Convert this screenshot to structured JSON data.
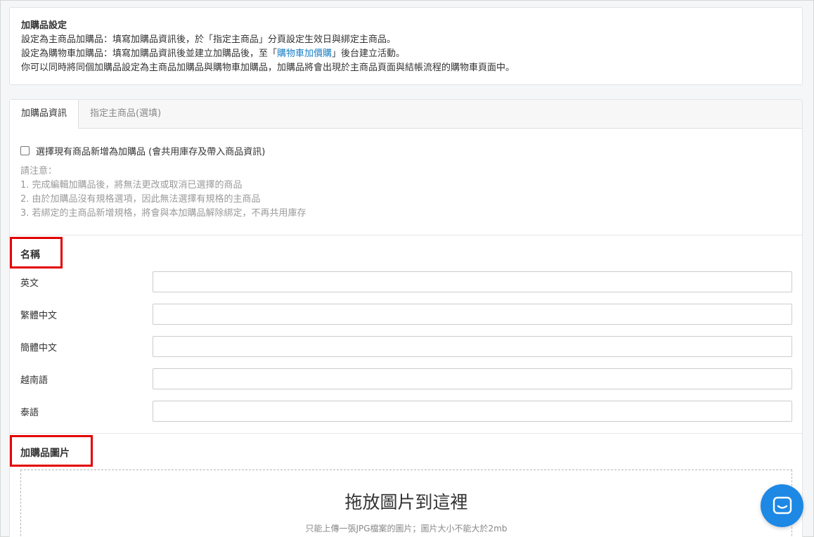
{
  "notice": {
    "title": "加購品設定",
    "line1": "設定為主商品加購品：填寫加購品資訊後，於「指定主商品」分頁設定生效日與綁定主商品。",
    "line2_prefix": "設定為購物車加購品：填寫加購品資訊後並建立加購品後，至「",
    "line2_link": "購物車加價購",
    "line2_suffix": "」後台建立活動。",
    "line3": "你可以同時將同個加購品設定為主商品加購品與購物車加購品，加購品將會出現於主商品頁面與結帳流程的購物車頁面中。"
  },
  "tabs": [
    {
      "label": "加購品資訊",
      "active": true
    },
    {
      "label": "指定主商品(選填)",
      "active": false
    }
  ],
  "existing_product": {
    "checkbox_label": "選擇現有商品新增為加購品 (會共用庫存及帶入商品資訊)",
    "checked": false,
    "notes": [
      "請注意：",
      "1. 完成編輯加購品後，將無法更改或取消已選擇的商品",
      "2. 由於加購品沒有規格選項，因此無法選擇有規格的主商品",
      "3. 若綁定的主商品新增規格，將會與本加購品解除綁定，不再共用庫存"
    ]
  },
  "name_section": {
    "title": "名稱",
    "fields": [
      {
        "label": "英文",
        "value": ""
      },
      {
        "label": "繁體中文",
        "value": ""
      },
      {
        "label": "簡體中文",
        "value": ""
      },
      {
        "label": "越南語",
        "value": ""
      },
      {
        "label": "泰語",
        "value": ""
      }
    ]
  },
  "image_section": {
    "title": "加購品圖片",
    "drop_title": "拖放圖片到這裡",
    "drop_hint": "只能上傳一張JPG檔案的圖片；圖片大小不能大於2mb"
  },
  "colors": {
    "highlight": "#e30000",
    "link": "#1b7fc4",
    "chat": "#1e88e5"
  },
  "icons": {
    "chat": "chat-bubble-icon"
  }
}
